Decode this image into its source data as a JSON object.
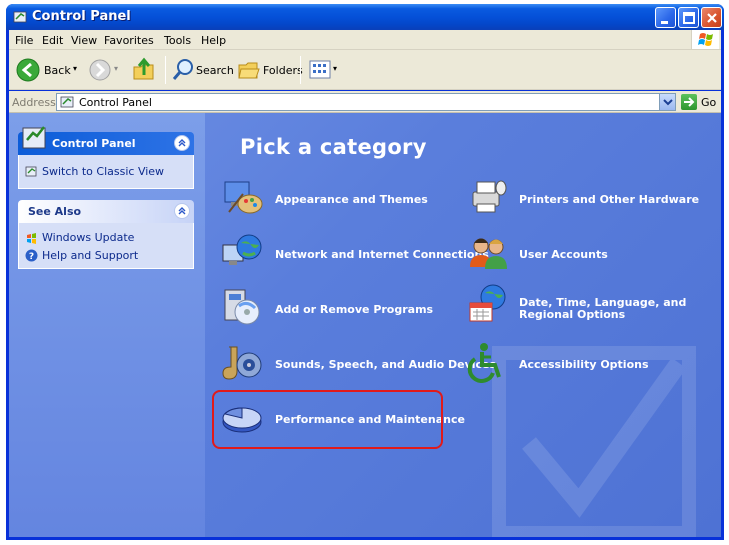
{
  "window": {
    "title": "Control Panel"
  },
  "menu": [
    "File",
    "Edit",
    "View",
    "Favorites",
    "Tools",
    "Help"
  ],
  "toolbar": {
    "back_label": "Back",
    "search_label": "Search",
    "folders_label": "Folders"
  },
  "address": {
    "label": "Address",
    "value": "Control Panel",
    "go_label": "Go"
  },
  "sidebar": {
    "control_panel": {
      "title": "Control Panel",
      "switch_label": "Switch to Classic View"
    },
    "see_also": {
      "title": "See Also",
      "items": [
        "Windows Update",
        "Help and Support"
      ]
    }
  },
  "main": {
    "title": "Pick a category",
    "categories": [
      "Appearance and Themes",
      "Printers and Other Hardware",
      "Network and Internet Connections",
      "User Accounts",
      "Add or Remove Programs",
      "Date, Time, Language, and Regional Options",
      "Sounds, Speech, and Audio Devices",
      "Accessibility Options",
      "Performance and Maintenance"
    ]
  },
  "colors": {
    "highlight": "#e11a1a",
    "title_bar": "#0550d8",
    "content_bg": "#5a7edc"
  }
}
